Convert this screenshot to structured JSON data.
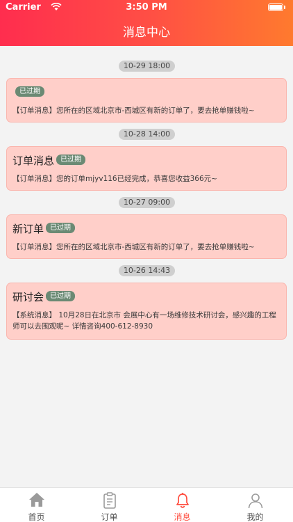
{
  "status_bar": {
    "carrier": "Carrier",
    "time": "3:50 PM"
  },
  "header": {
    "title": "消息中心"
  },
  "messages": [
    {
      "time": "10-29 18:00",
      "title": "",
      "badge": "已过期",
      "body": "【订单消息】您所在的区域北京市-西城区有新的订单了，要去抢单赚钱啦~"
    },
    {
      "time": "10-28 14:00",
      "title": "订单消息",
      "badge": "已过期",
      "body": "【订单消息】您的订单mjyv116已经完成，恭喜您收益366元~"
    },
    {
      "time": "10-27 09:00",
      "title": "新订单",
      "badge": "已过期",
      "body": "【订单消息】您所在的区域北京市-西城区有新的订单了，要去抢单赚钱啦~"
    },
    {
      "time": "10-26 14:43",
      "title": "研讨会",
      "badge": "已过期",
      "body": "【系统消息】 10月28日在北京市 会展中心有一场维修技术研讨会，感兴趣的工程师可以去围观呢~ 详情咨询400-612-8930"
    }
  ],
  "tabbar": {
    "items": [
      {
        "label": "首页",
        "icon": "home-icon",
        "active": false
      },
      {
        "label": "订单",
        "icon": "clipboard-icon",
        "active": false
      },
      {
        "label": "消息",
        "icon": "bell-icon",
        "active": true
      },
      {
        "label": "我的",
        "icon": "user-icon",
        "active": false
      }
    ]
  },
  "colors": {
    "accent": "#ff4b3d",
    "card_bg": "#ffcfc9",
    "badge_bg": "#6b8a74"
  }
}
